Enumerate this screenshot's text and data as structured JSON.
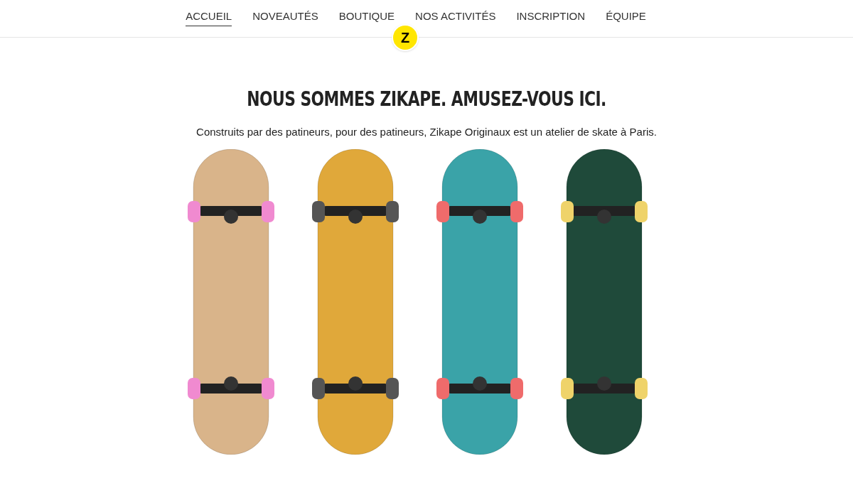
{
  "nav": [
    {
      "label": "ACCUEIL",
      "selected": true
    },
    {
      "label": "NOVEAUTÉS",
      "selected": false
    },
    {
      "label": "BOUTIQUE",
      "selected": false
    },
    {
      "label": "NOS ACTIVITÉS",
      "selected": false
    },
    {
      "label": "INSCRIPTION",
      "selected": false
    },
    {
      "label": "ÉQUIPE",
      "selected": false
    }
  ],
  "logo": "Z",
  "hero": {
    "title": "NOUS SOMMES ZIKAPE. AMUSEZ-VOUS ICI.",
    "subtitle": "Construits par des patineurs, pour des patineurs, Zikape Originaux est un atelier de skate à Paris."
  },
  "skateboards": [
    {
      "color": "#d9b48a",
      "wheels": {
        "color": "#f08ad0"
      }
    },
    {
      "color": "#e0a83a",
      "wheels": {
        "color": "#555555"
      }
    },
    {
      "color": "#3aa3a8",
      "wheels": {
        "color": "#ef6b6b"
      }
    },
    {
      "color": "#1f4a3a",
      "wheels": {
        "color": "#efd36a"
      }
    }
  ]
}
